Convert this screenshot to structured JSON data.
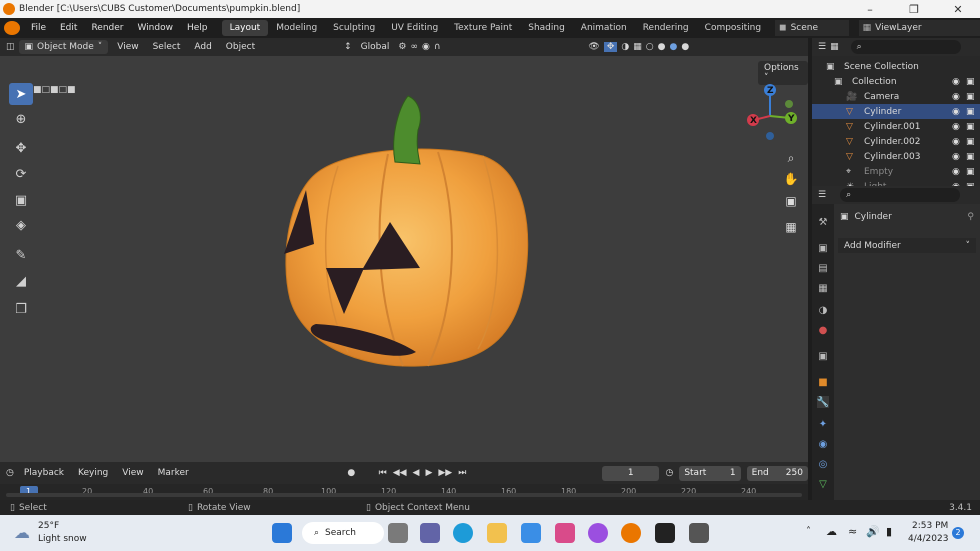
{
  "window": {
    "title": "Blender [C:\\Users\\CUBS Customer\\Documents\\pumpkin.blend]"
  },
  "menus": [
    "File",
    "Edit",
    "Render",
    "Window",
    "Help"
  ],
  "workspaces": [
    {
      "label": "Layout",
      "active": true
    },
    {
      "label": "Modeling"
    },
    {
      "label": "Sculpting"
    },
    {
      "label": "UV Editing"
    },
    {
      "label": "Texture Paint"
    },
    {
      "label": "Shading"
    },
    {
      "label": "Animation"
    },
    {
      "label": "Rendering"
    },
    {
      "label": "Compositing"
    }
  ],
  "scene": {
    "label": "Scene"
  },
  "view_layer": {
    "label": "ViewLayer"
  },
  "viewport_header": {
    "mode": "Object Mode",
    "menus": [
      "View",
      "Select",
      "Add",
      "Object"
    ],
    "transform_orientation": "Global"
  },
  "viewport": {
    "options_label": "Options",
    "gizmo": {
      "x": "X",
      "y": "Y",
      "z": "Z"
    }
  },
  "timeline": {
    "menus": [
      "Playback",
      "Keying",
      "View",
      "Marker"
    ],
    "current_frame": "1",
    "start_label": "Start",
    "start_value": "1",
    "end_label": "End",
    "end_value": "250",
    "ruler": [
      "1",
      "20",
      "40",
      "60",
      "80",
      "100",
      "120",
      "140",
      "160",
      "180",
      "200",
      "220",
      "240"
    ]
  },
  "statusbar": {
    "select": "Select",
    "rotate": "Rotate View",
    "context": "Object Context Menu",
    "version": "3.4.1"
  },
  "outliner": {
    "root": "Scene Collection",
    "collection": "Collection",
    "items": [
      {
        "label": "Camera",
        "icon": "camera-icon",
        "selected": false
      },
      {
        "label": "Cylinder",
        "icon": "mesh-icon",
        "selected": true
      },
      {
        "label": "Cylinder.001",
        "icon": "mesh-icon",
        "selected": false
      },
      {
        "label": "Cylinder.002",
        "icon": "mesh-icon",
        "selected": false
      },
      {
        "label": "Cylinder.003",
        "icon": "mesh-icon",
        "selected": false
      },
      {
        "label": "Empty",
        "icon": "empty-icon",
        "selected": false
      },
      {
        "label": "Light",
        "icon": "light-icon",
        "selected": false
      }
    ]
  },
  "properties": {
    "object_name": "Cylinder",
    "add_modifier": "Add Modifier"
  },
  "taskbar": {
    "weather_temp": "25°F",
    "weather_desc": "Light snow",
    "search": "Search",
    "time": "2:53 PM",
    "date": "4/4/2023",
    "notifications": "2"
  },
  "colors": {
    "accent": "#4772b3",
    "selection": "#334d80",
    "pumpkin": "#f2a23f",
    "stem": "#4a8a2c"
  }
}
